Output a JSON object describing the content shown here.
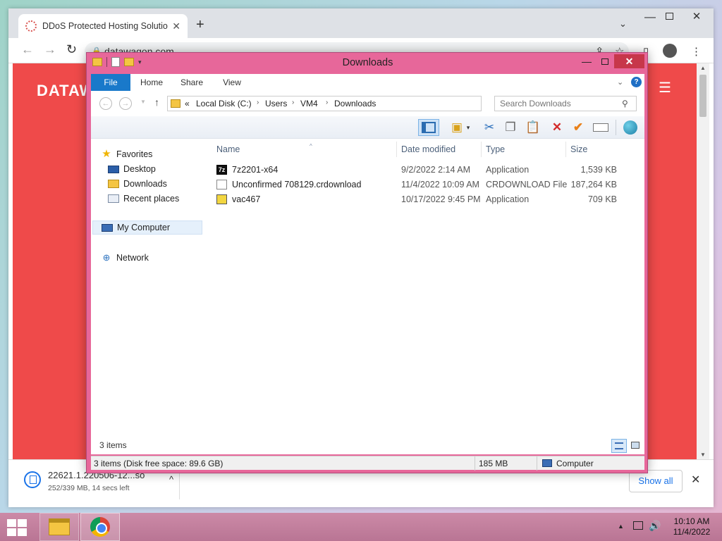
{
  "browser": {
    "tab_title": "DDoS Protected Hosting Solution",
    "tab_close": "✕",
    "new_tab": "+",
    "tab_search": "⌄",
    "window_min": "—",
    "window_close": "✕",
    "nav_back": "←",
    "nav_forward": "→",
    "nav_reload": "↻",
    "url": "datawagon.com",
    "toolbar_icons": [
      "share-icon",
      "star-icon",
      "sidebar-icon",
      "profile-avatar",
      "menu-kebab-icon"
    ],
    "page_logo": "DATAW",
    "page_menu": "☰",
    "scroll_up": "▲",
    "scroll_down": "▼"
  },
  "download": {
    "name": "22621.1.220506-12...so",
    "status": "252/339 MB, 14 secs left",
    "chevron": "^",
    "show_all": "Show all",
    "close": "✕"
  },
  "explorer": {
    "title": "Downloads",
    "min": "—",
    "close": "✕",
    "ribbon_tabs": [
      "File",
      "Home",
      "Share",
      "View"
    ],
    "ribbon_expand": "⌄",
    "help": "?",
    "nav_back": "←",
    "nav_forward": "→",
    "nav_recent": "▼",
    "nav_up": "↑",
    "address_prefix": "«",
    "breadcrumb": [
      "Local Disk (C:)",
      "Users",
      "VM4",
      "Downloads"
    ],
    "breadcrumb_sep": "›",
    "address_dropdown": "⌄",
    "refresh": "↻",
    "search_placeholder": "Search Downloads",
    "search_icon": "⚲",
    "cmd_icons": {
      "props_dd": "▾",
      "cut": "✂",
      "copy": "❐",
      "paste": "📋",
      "delete": "✕",
      "check": "✔"
    },
    "nav_tree": {
      "favorites": "Favorites",
      "desktop": "Desktop",
      "downloads": "Downloads",
      "recent": "Recent places",
      "computer": "My Computer",
      "network": "Network",
      "star": "★",
      "network_icon": "⊕"
    },
    "columns": {
      "name": "Name",
      "date": "Date modified",
      "type": "Type",
      "size": "Size",
      "sort_caret": "^"
    },
    "files": [
      {
        "name": "7z2201-x64",
        "date": "9/2/2022 2:14 AM",
        "type": "Application",
        "size": "1,539 KB",
        "icon": "7z"
      },
      {
        "name": "Unconfirmed 708129.crdownload",
        "date": "11/4/2022 10:09 AM",
        "type": "CRDOWNLOAD File",
        "size": "187,264 KB",
        "icon": ""
      },
      {
        "name": "vac467",
        "date": "10/17/2022 9:45 PM",
        "type": "Application",
        "size": "709 KB",
        "icon": ""
      }
    ],
    "item_count": "3 items",
    "status_main": "3 items (Disk free space: 89.6 GB)",
    "status_size": "185 MB",
    "status_location": "Computer"
  },
  "taskbar": {
    "tray_up": "▲",
    "volume": "🔊",
    "time": "10:10 AM",
    "date": "11/4/2022"
  },
  "colors": {
    "window_frame": "#e7679a",
    "ribbon_file_tab": "#1979ca",
    "page_red": "#ef4a4a",
    "taskbar": "#c07e9c"
  }
}
